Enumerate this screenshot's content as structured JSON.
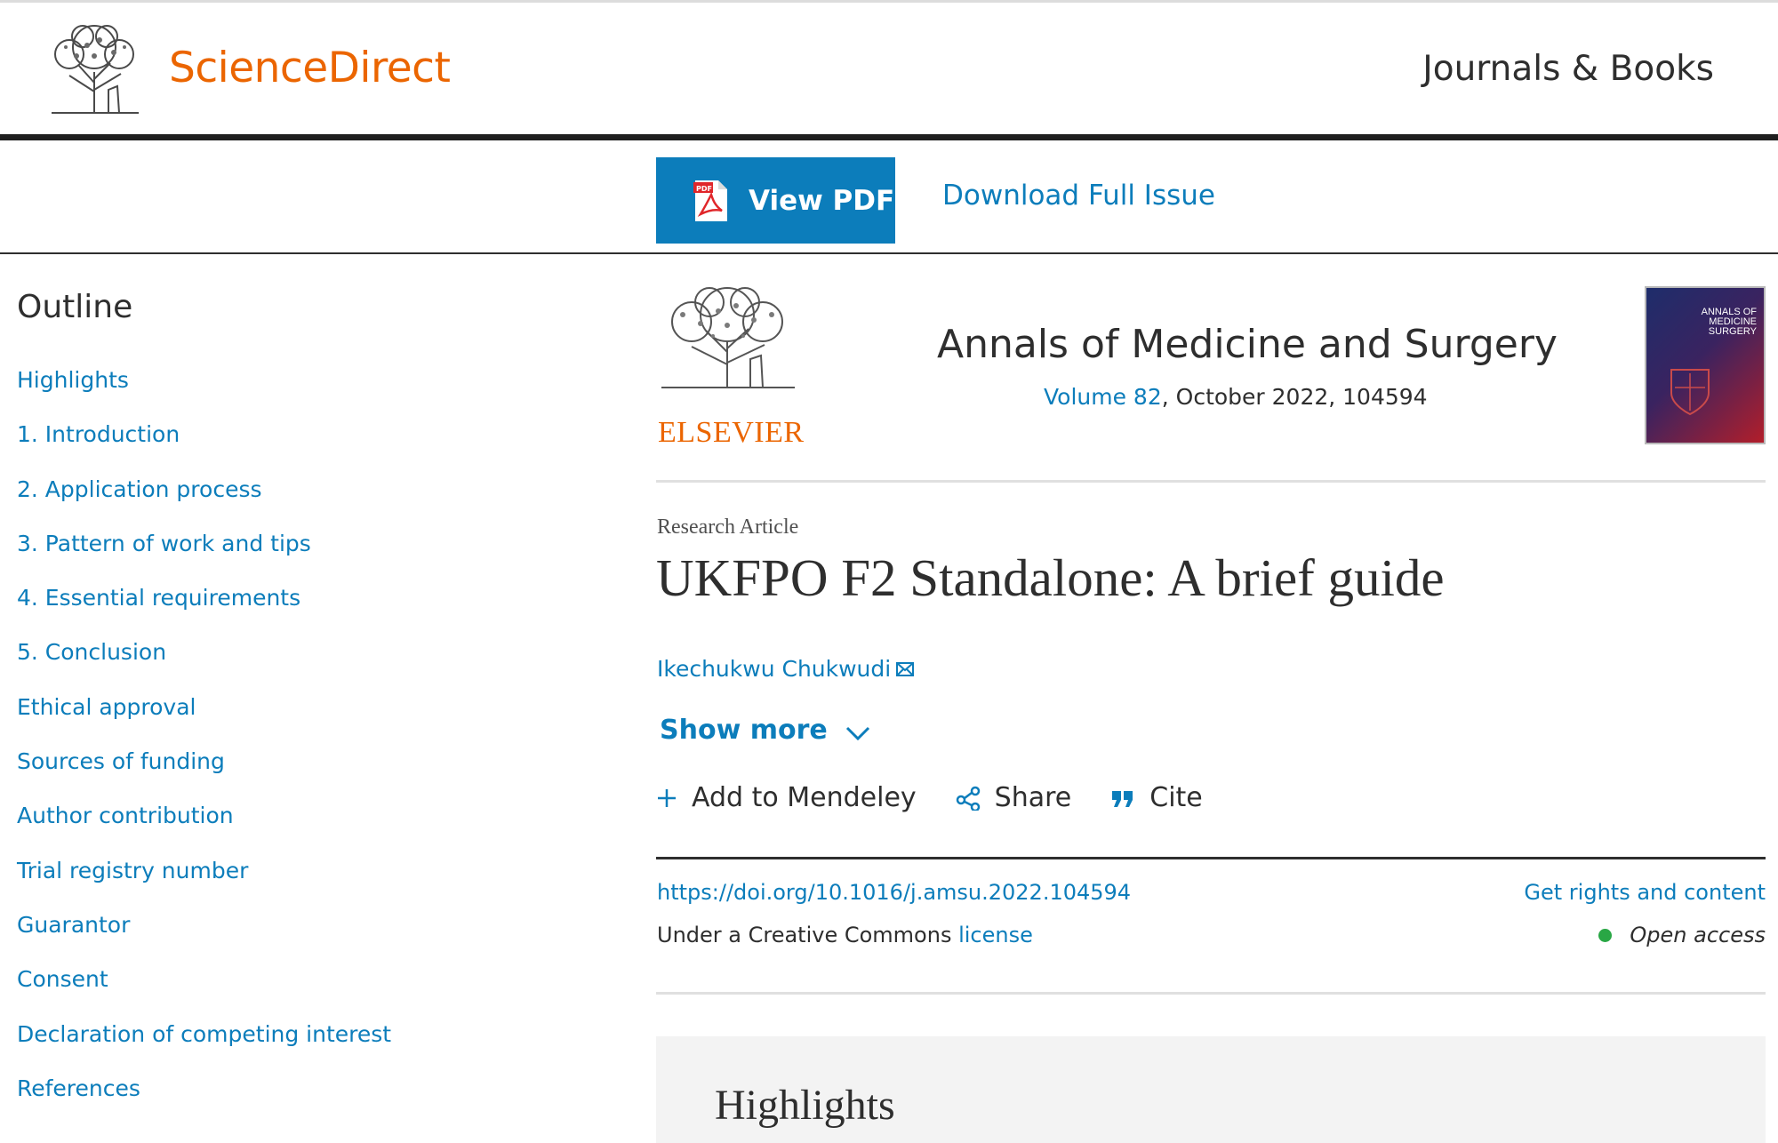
{
  "header": {
    "brand": "ScienceDirect",
    "journals_books": "Journals & Books"
  },
  "toolbar": {
    "view_pdf": "View PDF",
    "download_issue": "Download Full Issue"
  },
  "outline": {
    "title": "Outline",
    "items": [
      "Highlights",
      "1. Introduction",
      "2. Application process",
      "3. Pattern of work and tips",
      "4. Essential requirements",
      "5. Conclusion",
      "Ethical approval",
      "Sources of funding",
      "Author contribution",
      "Trial registry number",
      "Guarantor",
      "Consent",
      "Declaration of competing interest",
      "References"
    ]
  },
  "journal": {
    "publisher": "ELSEVIER",
    "title": "Annals of Medicine and Surgery",
    "volume": "Volume 82",
    "date_and_number": ", October 2022, 104594",
    "cover_title": "ANNALS OF\nMEDICINE\nSURGERY"
  },
  "article": {
    "type": "Research Article",
    "title": "UKFPO F2 Standalone: A brief guide",
    "author": "Ikechukwu Chukwudi",
    "show_more": "Show more",
    "actions": {
      "mendeley": "Add to Mendeley",
      "share": "Share",
      "cite": "Cite"
    },
    "doi": "https://doi.org/10.1016/j.amsu.2022.104594",
    "rights": "Get rights and content",
    "license_prefix": "Under a Creative Commons ",
    "license_link": "license",
    "open_access": "Open access",
    "highlights_heading": "Highlights"
  },
  "colors": {
    "brand_orange": "#eb6500",
    "link_blue": "#0c7dbb",
    "open_access_green": "#29a745"
  }
}
